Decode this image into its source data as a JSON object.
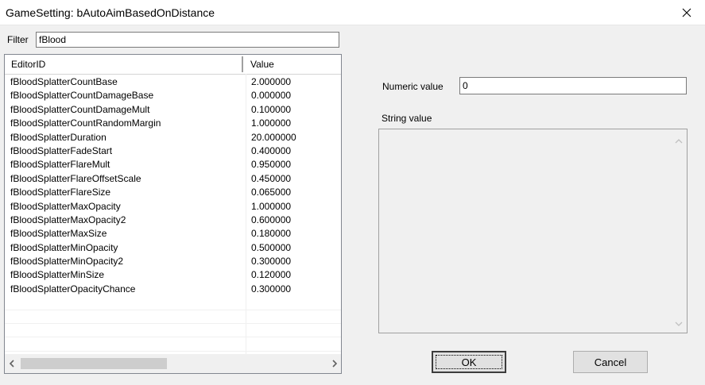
{
  "window": {
    "title": "GameSetting: bAutoAimBasedOnDistance"
  },
  "filter": {
    "label": "Filter",
    "value": "fBlood"
  },
  "list": {
    "columns": [
      "EditorID",
      "Value"
    ],
    "rows": [
      [
        "fBloodSplatterCountBase",
        "2.000000"
      ],
      [
        "fBloodSplatterCountDamageBase",
        "0.000000"
      ],
      [
        "fBloodSplatterCountDamageMult",
        "0.100000"
      ],
      [
        "fBloodSplatterCountRandomMargin",
        "1.000000"
      ],
      [
        "fBloodSplatterDuration",
        "20.000000"
      ],
      [
        "fBloodSplatterFadeStart",
        "0.400000"
      ],
      [
        "fBloodSplatterFlareMult",
        "0.950000"
      ],
      [
        "fBloodSplatterFlareOffsetScale",
        "0.450000"
      ],
      [
        "fBloodSplatterFlareSize",
        "0.065000"
      ],
      [
        "fBloodSplatterMaxOpacity",
        "1.000000"
      ],
      [
        "fBloodSplatterMaxOpacity2",
        "0.600000"
      ],
      [
        "fBloodSplatterMaxSize",
        "0.180000"
      ],
      [
        "fBloodSplatterMinOpacity",
        "0.500000"
      ],
      [
        "fBloodSplatterMinOpacity2",
        "0.300000"
      ],
      [
        "fBloodSplatterMinSize",
        "0.120000"
      ],
      [
        "fBloodSplatterOpacityChance",
        "0.300000"
      ]
    ],
    "scroll_fraction": 0.48
  },
  "numeric": {
    "label": "Numeric value",
    "value": "0"
  },
  "string": {
    "label": "String value",
    "value": ""
  },
  "buttons": {
    "ok_label": "OK",
    "cancel_label": "Cancel"
  },
  "icons": {
    "close": "close-icon",
    "scroll_left": "chevron-left-icon",
    "scroll_right": "chevron-right-icon",
    "scroll_up": "chevron-up-icon",
    "scroll_down": "chevron-down-icon"
  },
  "colors": {
    "background": "#f0f0f0",
    "button": "#e1e1e1",
    "scroll_thumb": "#cdcdcd"
  }
}
